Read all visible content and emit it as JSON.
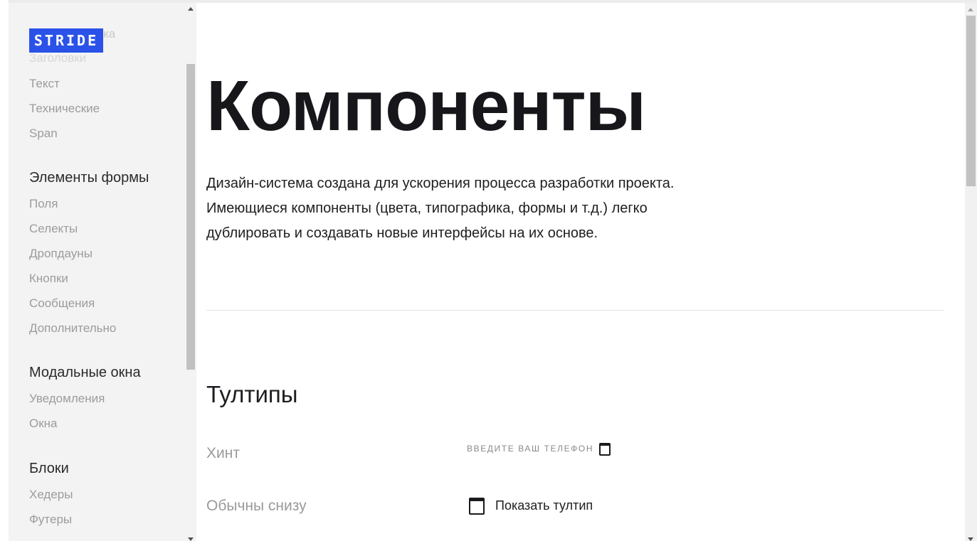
{
  "brand": {
    "logo_text": "STRIDE",
    "ghost_text": "ка"
  },
  "sidebar": {
    "items_top": [
      "Заголовки",
      "Текст",
      "Технические",
      "Span"
    ],
    "groups": [
      {
        "title": "Элементы формы",
        "items": [
          "Поля",
          "Селекты",
          "Дропдауны",
          "Кнопки",
          "Сообщения",
          "Дополнительно"
        ]
      },
      {
        "title": "Модальные окна",
        "items": [
          "Уведомления",
          "Окна"
        ]
      },
      {
        "title": "Блоки",
        "items": [
          "Хедеры",
          "Футеры"
        ]
      }
    ]
  },
  "main": {
    "title": "Компоненты",
    "intro_lines": [
      "Дизайн-система создана для ускорения процесса разработки проекта.",
      "Имеющиеся компоненты (цвета, типографика, формы и т.д.) легко",
      "дублировать и создавать новые интерфейсы на их основе."
    ],
    "section_title": "Тултипы",
    "rows": [
      {
        "label": "Хинт",
        "control_text": "ВВЕДИТЕ ВАШ ТЕЛЕФОН"
      },
      {
        "label": "Обычны снизу",
        "control_text": "Показать тултип"
      }
    ]
  },
  "colors": {
    "brand": "#2a52e8",
    "sidebar_bg": "#f3f3f3",
    "text": "#1a1a1e"
  }
}
